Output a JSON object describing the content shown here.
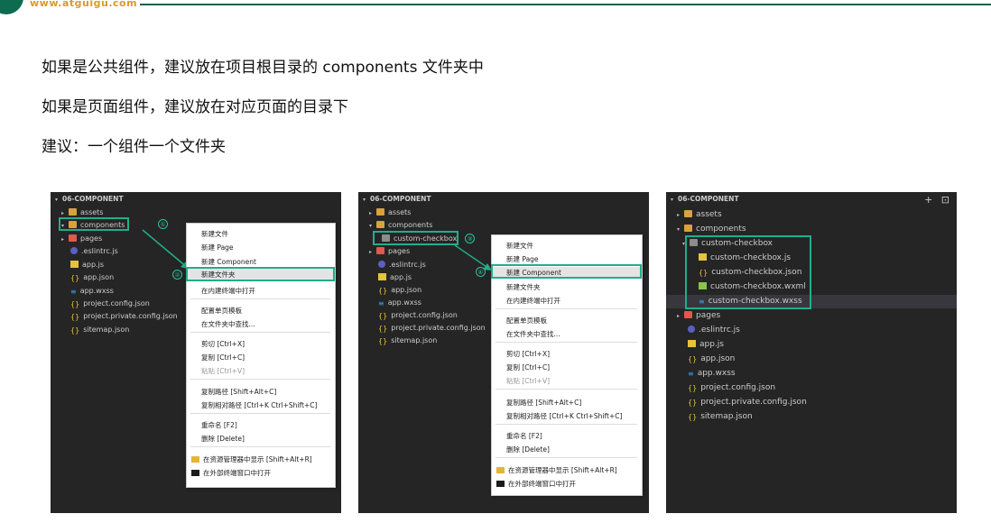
{
  "brand": {
    "url": "www.atguigu.com"
  },
  "headings": [
    "如果是公共组件，建议放在项目根目录的 components 文件夹中",
    "如果是页面组件，建议放在对应页面的目录下",
    "建议：一个组件一个文件夹"
  ],
  "panel1": {
    "title": "06-COMPONENT",
    "tree": [
      "assets",
      "components",
      "pages",
      ".eslintrc.js",
      "app.js",
      "app.json",
      "app.wxss",
      "project.config.json",
      "project.private.config.json",
      "sitemap.json"
    ],
    "step1": "①",
    "step2": "②"
  },
  "panel2": {
    "title": "06-COMPONENT",
    "tree": [
      "assets",
      "components",
      "custom-checkbox",
      "pages",
      ".eslintrc.js",
      "app.js",
      "app.json",
      "app.wxss",
      "project.config.json",
      "project.private.config.json",
      "sitemap.json"
    ],
    "step3": "③",
    "step4": "④"
  },
  "menu": {
    "new_file": "新建文件",
    "new_page": "新建 Page",
    "new_component": "新建 Component",
    "new_folder": "新建文件夹",
    "open_terminal": "在内建终端中打开",
    "page_template": "配置单页模板",
    "find_in_folder": "在文件夹中查找...",
    "cut": "剪切  [Ctrl+X]",
    "copy": "复制  [Ctrl+C]",
    "paste": "粘贴  [Ctrl+V]",
    "copy_path": "复制路径  [Shift+Alt+C]",
    "copy_rel_path": "复制相对路径  [Ctrl+K Ctrl+Shift+C]",
    "rename": "重命名  [F2]",
    "delete": "删除  [Delete]",
    "reveal": "在资源管理器中显示  [Shift+Alt+R]",
    "open_external": "在外部终端窗口中打开"
  },
  "panel3": {
    "title": "06-COMPONENT",
    "header_icons": [
      "+",
      "⊡"
    ],
    "tree": [
      "assets",
      "components",
      "custom-checkbox",
      "custom-checkbox.js",
      "custom-checkbox.json",
      "custom-checkbox.wxml",
      "custom-checkbox.wxss",
      "pages",
      ".eslintrc.js",
      "app.js",
      "app.json",
      "app.wxss",
      "project.config.json",
      "project.private.config.json",
      "sitemap.json"
    ]
  },
  "colors": {
    "accent": "#1fae8a",
    "panel_bg": "#252526",
    "brand_green": "#0f6b4f",
    "brand_orange": "#d99a2b"
  }
}
